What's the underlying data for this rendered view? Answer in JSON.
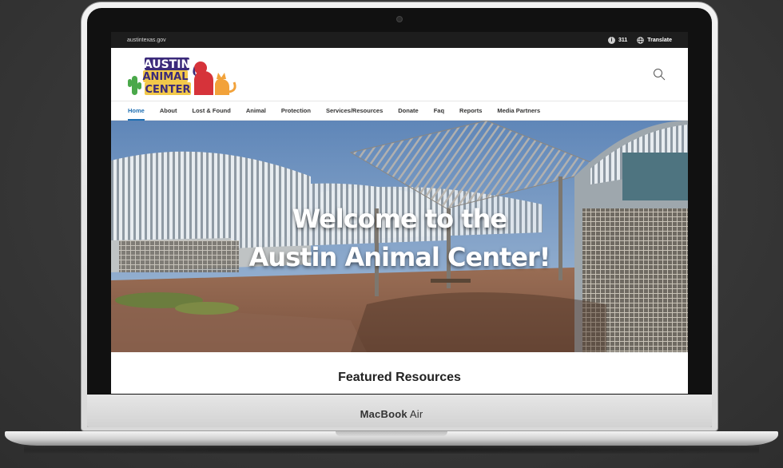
{
  "device": {
    "brand_bold": "MacBook",
    "brand_rest": " Air"
  },
  "topbar": {
    "site": "austintexas.gov",
    "info_icon": "info-icon",
    "phone_label": "311",
    "translate_icon": "globe-icon",
    "translate_label": "Translate"
  },
  "header": {
    "logo_lines": [
      "AUSTIN",
      "ANIMAL",
      "CENTER"
    ],
    "search_icon": "search-icon"
  },
  "nav": {
    "items": [
      {
        "label": "Home",
        "active": true
      },
      {
        "label": "About"
      },
      {
        "label": "Lost & Found"
      },
      {
        "label": "Animal"
      },
      {
        "label": "Protection"
      },
      {
        "label": "Services/Resources"
      },
      {
        "label": "Donate"
      },
      {
        "label": "Faq"
      },
      {
        "label": "Reports"
      },
      {
        "label": "Media Partners"
      }
    ]
  },
  "hero": {
    "line1": "Welcome to the",
    "line2": "Austin Animal Center!"
  },
  "featured": {
    "title": "Featured Resources"
  },
  "colors": {
    "accent": "#1f6fb2",
    "topbar": "#1d1d1d",
    "logo_purple": "#3b2a7a",
    "logo_green": "#4aa84a",
    "logo_red": "#d6333a",
    "logo_orange": "#f2a23a"
  }
}
